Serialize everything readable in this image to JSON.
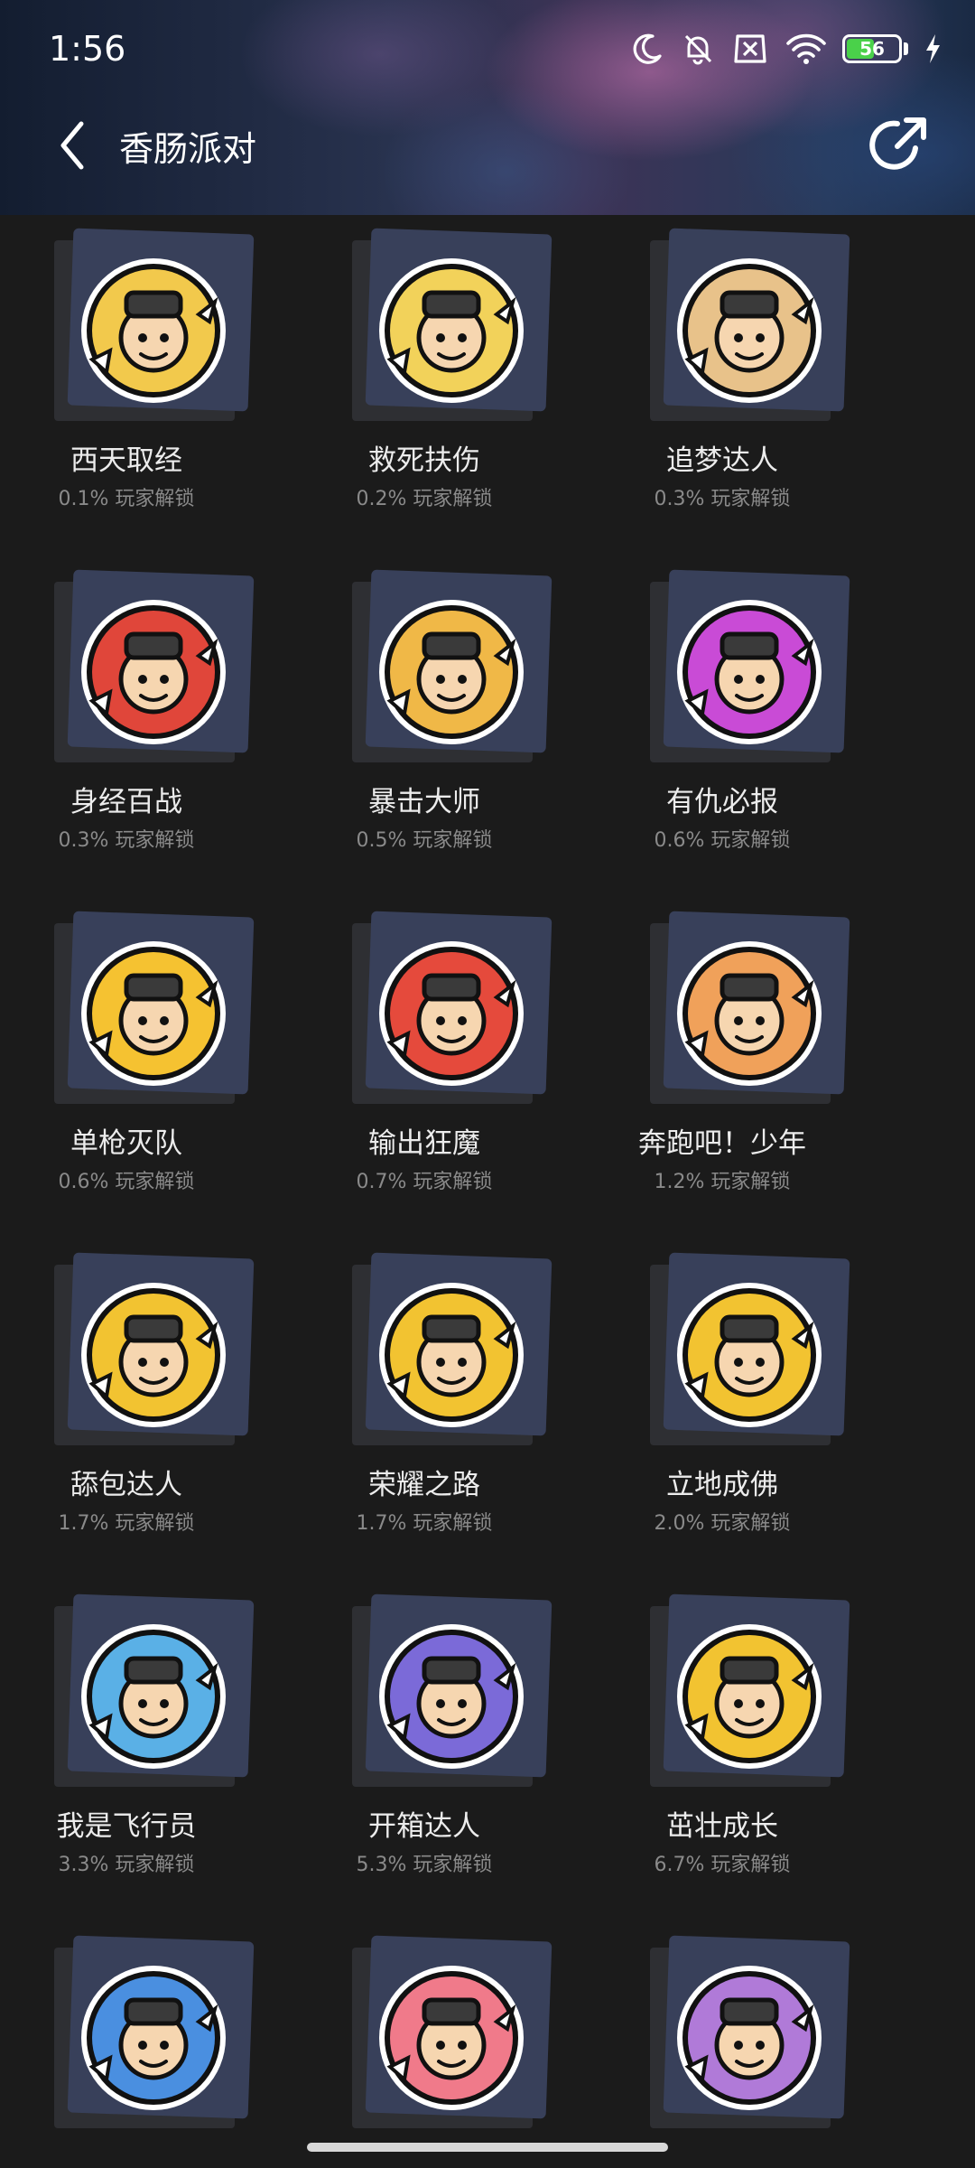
{
  "status_bar": {
    "time": "1:56",
    "battery_level": "56",
    "battery_fraction": 0.56,
    "icons": [
      "moon-icon",
      "bell-off-icon",
      "sim-x-icon",
      "wifi-icon",
      "battery-icon",
      "charging-bolt-icon"
    ]
  },
  "nav": {
    "title": "香肠派对",
    "back_icon": "chevron-left-icon",
    "share_icon": "share-icon"
  },
  "colors": {
    "background": "#1b1b1b",
    "card": "#38405a",
    "name_text": "#ececec",
    "sub_text": "#8a8a8a",
    "battery_green": "#4ad14a"
  },
  "achievements": [
    {
      "name": "西天取经",
      "rate": "0.1% 玩家解锁",
      "badge_color": "#f2c94c",
      "icon": "pig-monk-badge-icon"
    },
    {
      "name": "救死扶伤",
      "rate": "0.2% 玩家解锁",
      "badge_color": "#f2d25a",
      "icon": "medic-badge-icon"
    },
    {
      "name": "追梦达人",
      "rate": "0.3% 玩家解锁",
      "badge_color": "#e8c28a",
      "icon": "map-badge-icon"
    },
    {
      "name": "身经百战",
      "rate": "0.3% 玩家解锁",
      "badge_color": "#e0463a",
      "icon": "knight-badge-icon"
    },
    {
      "name": "暴击大师",
      "rate": "0.5% 玩家解锁",
      "badge_color": "#f0b847",
      "icon": "critical-hit-badge-icon"
    },
    {
      "name": "有仇必报",
      "rate": "0.6% 玩家解锁",
      "badge_color": "#c94bd6",
      "icon": "revenge-badge-icon"
    },
    {
      "name": "单枪灭队",
      "rate": "0.6% 玩家解锁",
      "badge_color": "#f5c231",
      "icon": "gunman-badge-icon"
    },
    {
      "name": "输出狂魔",
      "rate": "0.7% 玩家解锁",
      "badge_color": "#e54a3c",
      "icon": "minigun-badge-icon"
    },
    {
      "name": "奔跑吧！少年",
      "rate": "1.2% 玩家解锁",
      "badge_color": "#f0a15a",
      "icon": "runner-badge-icon"
    },
    {
      "name": "舔包达人",
      "rate": "1.7% 玩家解锁",
      "badge_color": "#f2c331",
      "icon": "loot-badge-icon"
    },
    {
      "name": "荣耀之路",
      "rate": "1.7% 玩家解锁",
      "badge_color": "#f2c331",
      "icon": "glory-badge-icon"
    },
    {
      "name": "立地成佛",
      "rate": "2.0% 玩家解锁",
      "badge_color": "#f2c331",
      "icon": "buddha-badge-icon"
    },
    {
      "name": "我是飞行员",
      "rate": "3.3% 玩家解锁",
      "badge_color": "#5ab0e6",
      "icon": "pilot-badge-icon"
    },
    {
      "name": "开箱达人",
      "rate": "5.3% 玩家解锁",
      "badge_color": "#7b6ad8",
      "icon": "crate-badge-icon"
    },
    {
      "name": "茁壮成长",
      "rate": "6.7% 玩家解锁",
      "badge_color": "#f2c331",
      "icon": "growth-badge-icon"
    },
    {
      "name": "",
      "rate": "",
      "badge_color": "#4a8fe0",
      "icon": "social-badge-icon"
    },
    {
      "name": "",
      "rate": "",
      "badge_color": "#f07a8a",
      "icon": "calendar-badge-icon"
    },
    {
      "name": "",
      "rate": "",
      "badge_color": "#b07ad8",
      "icon": "royal-badge-icon"
    }
  ]
}
